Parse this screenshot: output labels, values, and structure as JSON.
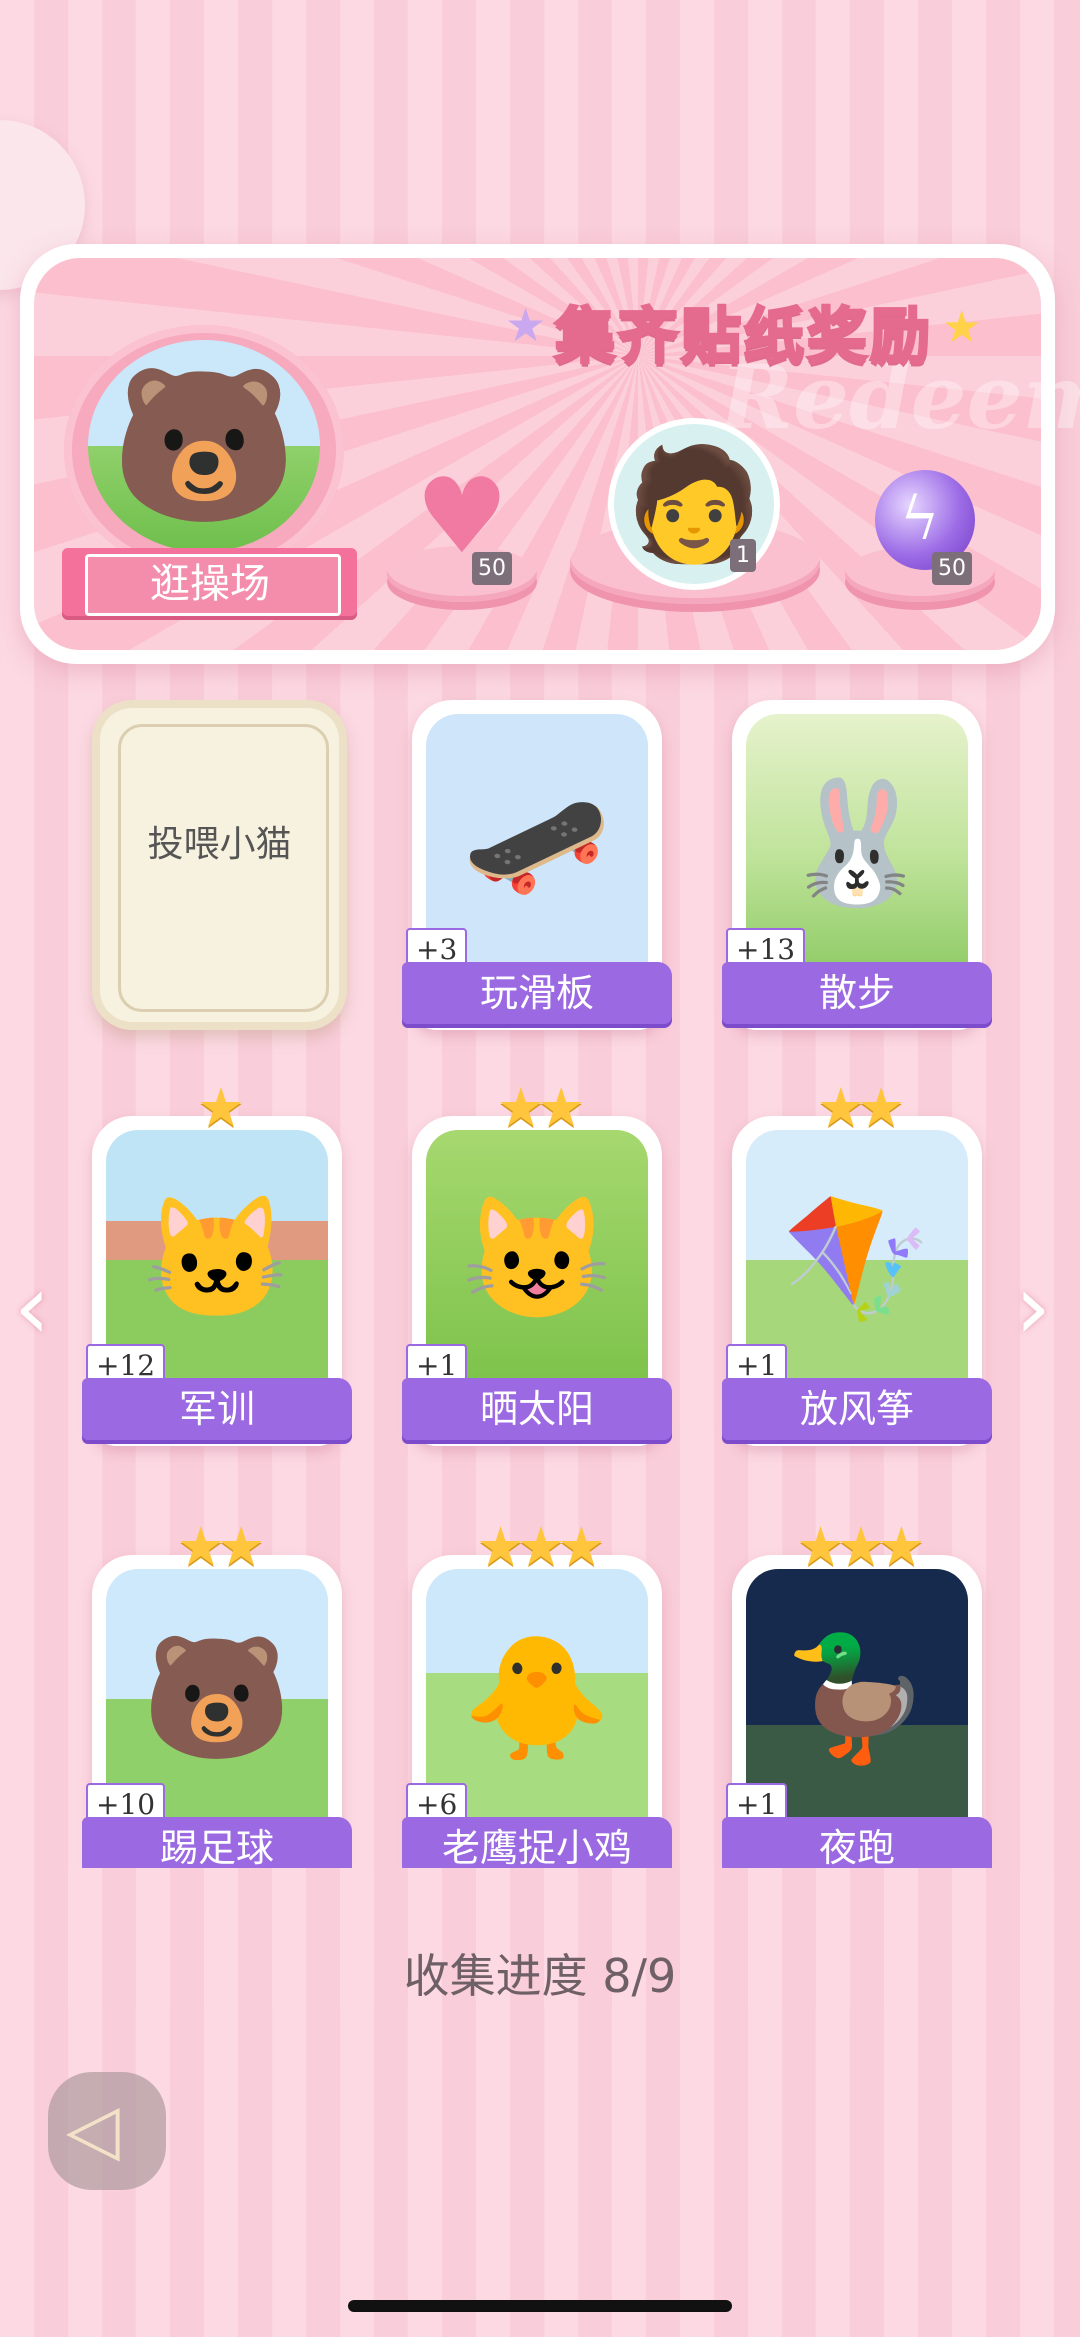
{
  "banner": {
    "title": "集齐贴纸奖励",
    "watermark": "Redeem",
    "current_sticker_label": "逛操场",
    "rewards": [
      {
        "icon": "pink-heart-gem-icon",
        "count": "50"
      },
      {
        "icon": "character-avatar-icon",
        "count": "1"
      },
      {
        "icon": "purple-lightning-orb-icon",
        "count": "50"
      }
    ]
  },
  "cards": [
    {
      "label": "投喂小猫",
      "locked": true
    },
    {
      "label": "玩滑板",
      "badge": "+3",
      "stars": 0,
      "icon": "skateboard-girl"
    },
    {
      "label": "散步",
      "badge": "+13",
      "stars": 0,
      "icon": "bunny-fox-walk"
    },
    {
      "label": "军训",
      "badge": "+12",
      "stars": 1,
      "icon": "soldier-cat"
    },
    {
      "label": "晒太阳",
      "badge": "+1",
      "stars": 2,
      "icon": "sunbathing-cat"
    },
    {
      "label": "放风筝",
      "badge": "+1",
      "stars": 2,
      "icon": "kite-bunny-dog"
    },
    {
      "label": "踢足球",
      "badge": "+10",
      "stars": 2,
      "icon": "soccer-bear"
    },
    {
      "label": "老鹰捉小鸡",
      "badge": "+6",
      "stars": 3,
      "icon": "eagle-chicks"
    },
    {
      "label": "夜跑",
      "badge": "+1",
      "stars": 3,
      "icon": "night-run-duck"
    }
  ],
  "progress": {
    "label": "收集进度",
    "value": "8/9",
    "text": "收集进度  8/9"
  },
  "colors": {
    "accent_purple": "#9b69e2",
    "pink": "#f3719a",
    "star": "#ffc53d"
  }
}
